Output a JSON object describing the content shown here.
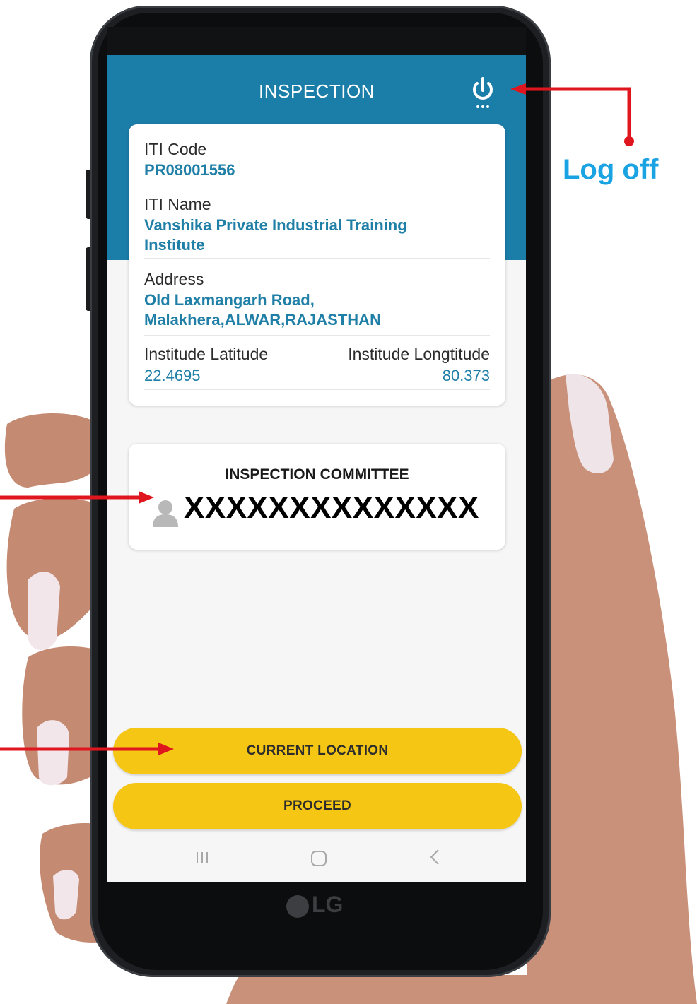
{
  "app": {
    "title": "INSPECTION",
    "logoff_annotation": "Log off"
  },
  "iti": {
    "code_label": "ITI Code",
    "code_value": "PR08001556",
    "name_label": "ITI Name",
    "name_value": "Vanshika Private Industrial Training Institute",
    "address_label": "Address",
    "address_value": "Old Laxmangarh Road, Malakhera,ALWAR,RAJASTHAN",
    "latitude_label": "Institude Latitude",
    "latitude_value": "22.4695",
    "longitude_label": "Institude Longtitude",
    "longitude_value": "80.373"
  },
  "committee": {
    "title": "INSPECTION COMMITTEE",
    "member_name_masked": "XXXXXXXXXXXXXX"
  },
  "buttons": {
    "current_location": "CURRENT LOCATION",
    "proceed": "PROCEED"
  },
  "device": {
    "brand": "LG"
  },
  "colors": {
    "appbar": "#1b7ea9",
    "value_text": "#1f7fa6",
    "button": "#f6c614",
    "annotation_arrow": "#e0161e",
    "annotation_text": "#1aa3e2"
  },
  "icons": [
    "power-icon",
    "person-icon",
    "nav-recent-icon",
    "nav-home-icon",
    "nav-back-icon",
    "lg-logo-icon"
  ]
}
